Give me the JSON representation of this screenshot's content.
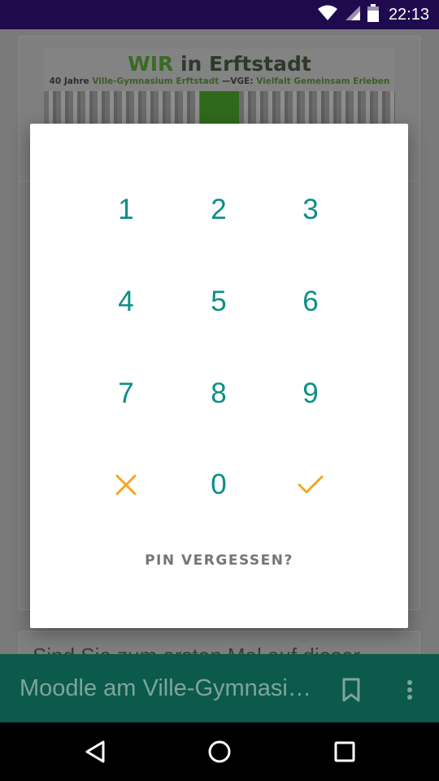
{
  "status_bar": {
    "time": "22:13",
    "icons": [
      "wifi-icon",
      "cell-signal-icon",
      "battery-icon"
    ]
  },
  "background": {
    "banner": {
      "title_green": "WIR",
      "title_rest": " in Erftstadt",
      "subtitle_a": "40 Jahre ",
      "subtitle_b": "Ville-Gymnasium Erftstadt",
      "subtitle_c": " —VGE: ",
      "subtitle_d": "Vielfalt Gemeinsam Erleben"
    },
    "card2_text": "Sind Sie zum ersten Mal auf dieser"
  },
  "app_bar": {
    "title": "Moodle am Ville-Gymnasium Erftstadt",
    "icons": [
      "bookmark-icon",
      "more-vert-icon"
    ]
  },
  "pin_dialog": {
    "keys": [
      "1",
      "2",
      "3",
      "4",
      "5",
      "6",
      "7",
      "8",
      "9",
      "0"
    ],
    "cancel_icon": "close-icon",
    "confirm_icon": "check-icon",
    "forgot_label": "PIN VERGESSEN?"
  },
  "nav_bar": {
    "icons": [
      "back-icon",
      "home-icon",
      "recents-icon"
    ]
  },
  "colors": {
    "status_bar": "#1f0a4e",
    "key_teal": "#0a8f85",
    "action_orange": "#f5a623",
    "app_bar": "#0b5a4b",
    "forgot_gray": "#757575"
  }
}
